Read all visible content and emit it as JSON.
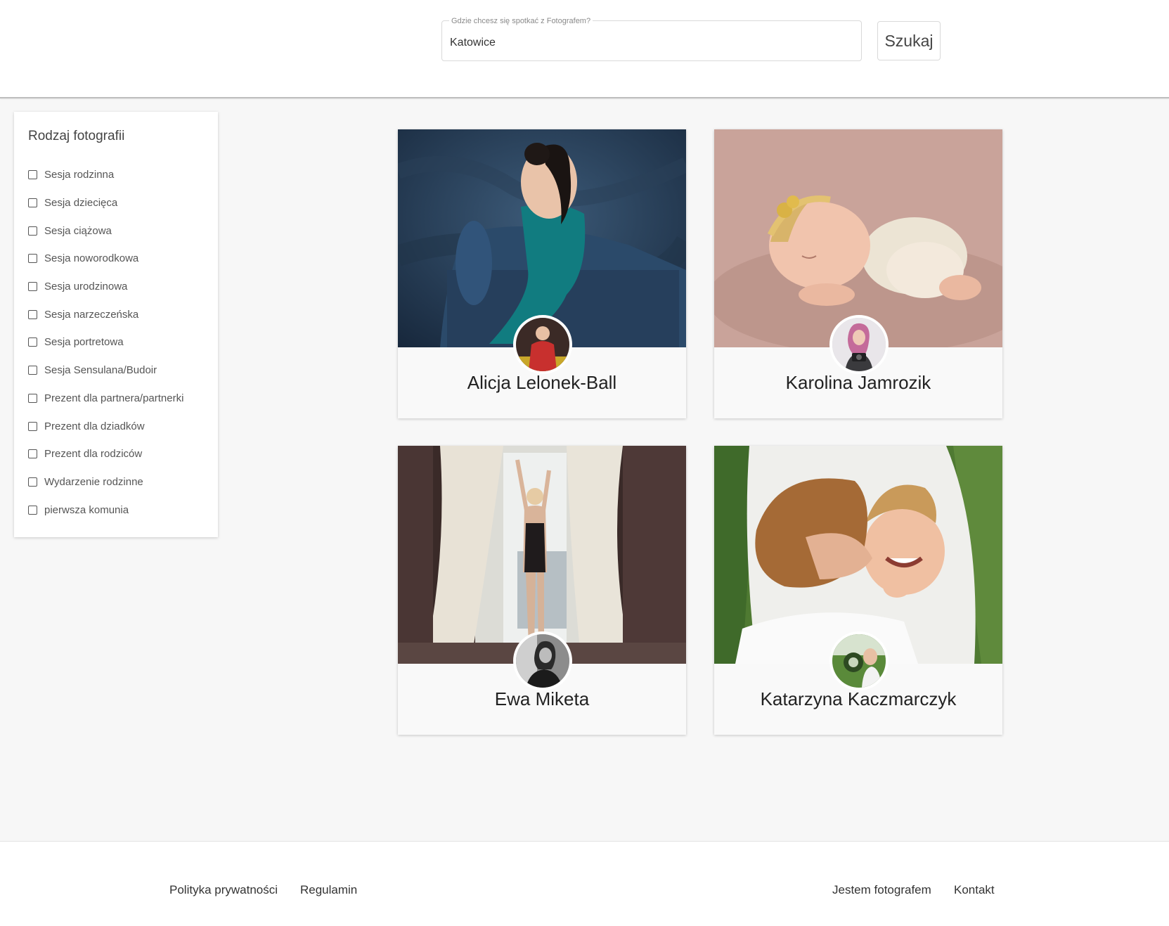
{
  "search": {
    "label": "Gdzie chcesz się spotkać z Fotografem?",
    "value": "Katowice",
    "button_label": "Szukaj"
  },
  "filters": {
    "title": "Rodzaj fotografii",
    "items": [
      {
        "label": "Sesja rodzinna",
        "checked": false
      },
      {
        "label": "Sesja dziecięca",
        "checked": false
      },
      {
        "label": "Sesja ciążowa",
        "checked": false
      },
      {
        "label": "Sesja noworodkowa",
        "checked": false
      },
      {
        "label": "Sesja urodzinowa",
        "checked": false
      },
      {
        "label": "Sesja narzeczeńska",
        "checked": false
      },
      {
        "label": "Sesja portretowa",
        "checked": false
      },
      {
        "label": "Sesja Sensulana/Budoir",
        "checked": false
      },
      {
        "label": "Prezent dla partnera/partnerki",
        "checked": false
      },
      {
        "label": "Prezent dla dziadków",
        "checked": false
      },
      {
        "label": "Prezent dla rodziców",
        "checked": false
      },
      {
        "label": "Wydarzenie rodzinne",
        "checked": false
      },
      {
        "label": "pierwsza komunia",
        "checked": false
      }
    ]
  },
  "photographers": [
    {
      "name": "Alicja Lelonek-Ball",
      "photo_icon": "woman-teal-dress-photo",
      "avatar_icon": "avatar-red-dress"
    },
    {
      "name": "Karolina Jamrozik",
      "photo_icon": "newborn-baby-photo",
      "avatar_icon": "avatar-pink-hair-camera"
    },
    {
      "name": "Ewa Miketa",
      "photo_icon": "woman-window-curtains-photo",
      "avatar_icon": "avatar-black-white"
    },
    {
      "name": "Katarzyna Kaczmarczyk",
      "photo_icon": "mother-child-grass-photo",
      "avatar_icon": "avatar-green-lens"
    }
  ],
  "footer": {
    "left_links": [
      "Polityka prywatności",
      "Regulamin"
    ],
    "right_links": [
      "Jestem fotografem",
      "Kontakt"
    ]
  }
}
